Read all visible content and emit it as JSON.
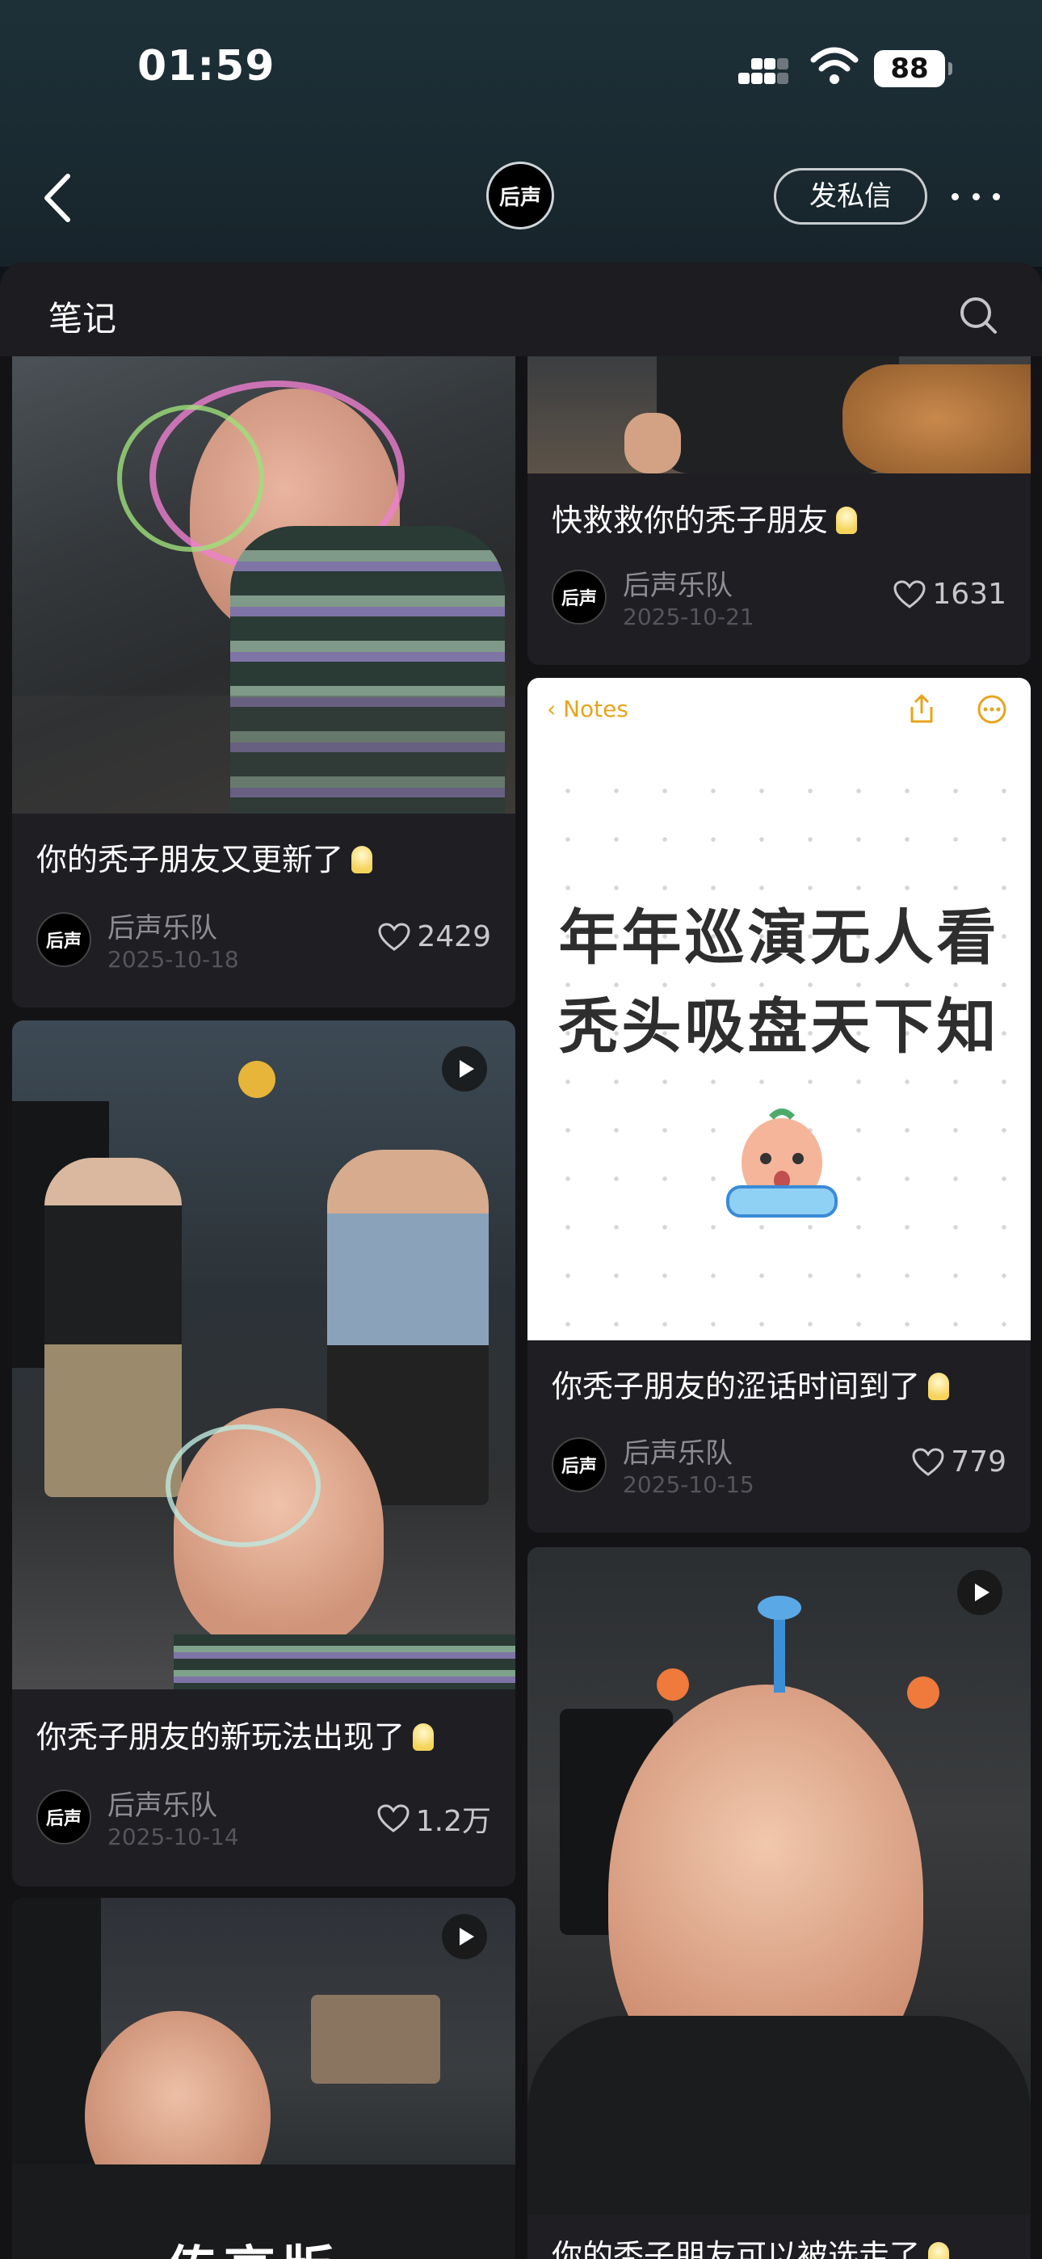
{
  "status_bar": {
    "time": "01:59",
    "battery": "88"
  },
  "header": {
    "logo_text": "后声",
    "message_button": "发私信"
  },
  "section": {
    "title": "笔记"
  },
  "colors": {
    "accent": "#e5a51c",
    "background": "#131316",
    "card": "#1e1e23",
    "header": "#1a2a31"
  },
  "posts": [
    {
      "title": "你的秃子朋友又更新了",
      "author": "后声乐队",
      "date": "2025-10-18",
      "likes": "2429"
    },
    {
      "title": "你秃子朋友的新玩法出现了",
      "author": "后声乐队",
      "date": "2025-10-14",
      "likes": "1.2万"
    },
    {
      "title": "快救救你的秃子朋友",
      "author": "后声乐队",
      "date": "2025-10-21",
      "likes": "1631"
    },
    {
      "title": "你秃子朋友的涩话时间到了",
      "author": "后声乐队",
      "date": "2025-10-15",
      "likes": "779"
    },
    {
      "title": "你的秃子朋友可以被选走了",
      "author": "后声乐队",
      "date": "",
      "likes": ""
    }
  ],
  "notes_image": {
    "back_label": "Notes",
    "line1": "年年巡演无人看",
    "line2": "秃头吸盘天下知"
  },
  "cover_caption": "传高版"
}
